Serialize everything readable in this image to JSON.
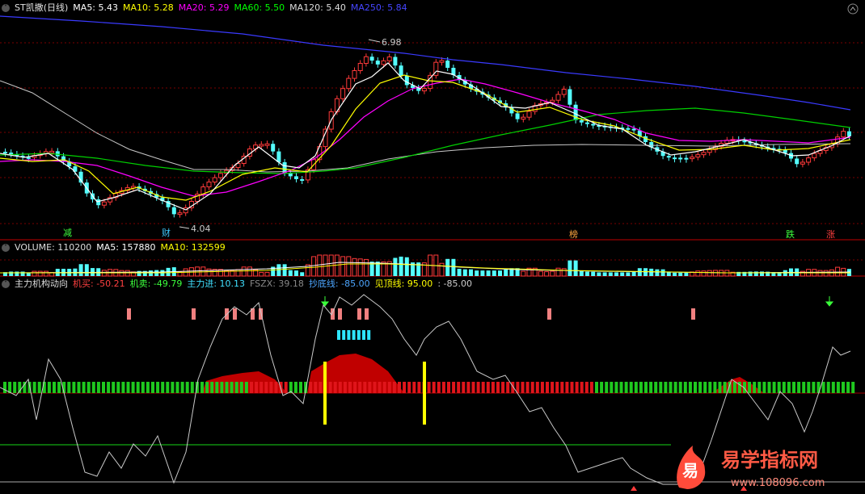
{
  "main_legend": {
    "title": "ST凯撒(日线)",
    "ma5": "MA5: 5.43",
    "ma10": "MA10: 5.28",
    "ma20": "MA20: 5.29",
    "ma60": "MA60: 5.50",
    "ma120": "MA120: 5.40",
    "ma250": "MA250: 5.84"
  },
  "price_labels": {
    "high": "6.98",
    "low": "4.04"
  },
  "signal_labels": {
    "reduce": "减",
    "finance": "财",
    "list": "榜",
    "fall": "跌",
    "rise": "涨"
  },
  "volume_legend": {
    "title": "VOLUME: 110200",
    "ma5": "MA5: 157880",
    "ma10": "MA10: 132599"
  },
  "indicator_legend": {
    "title": "主力机构动向",
    "buy": "机买: -50.21",
    "sell": "机卖: -49.79",
    "inflow": "主力进: 10.13",
    "fszx": "FSZX: 39.18",
    "bottom": "抄底线: -85.00",
    "top": "见顶线: 95.00",
    "extra": ": -85.00"
  },
  "watermark": {
    "brand": "易学指标网",
    "url": "www.108096.com",
    "logo_char": "易"
  },
  "colors": {
    "ma5": "#ffffff",
    "ma10": "#ffff00",
    "ma20": "#ff00ff",
    "ma60": "#00ff00",
    "ma120": "#c8c8c8",
    "ma250": "#3a3aff",
    "up": "#ff3a3a",
    "down": "#54ffff",
    "signal_green": "#1a8f1a",
    "signal_red": "#d8262b",
    "accent_yellow": "#ffff00"
  }
}
